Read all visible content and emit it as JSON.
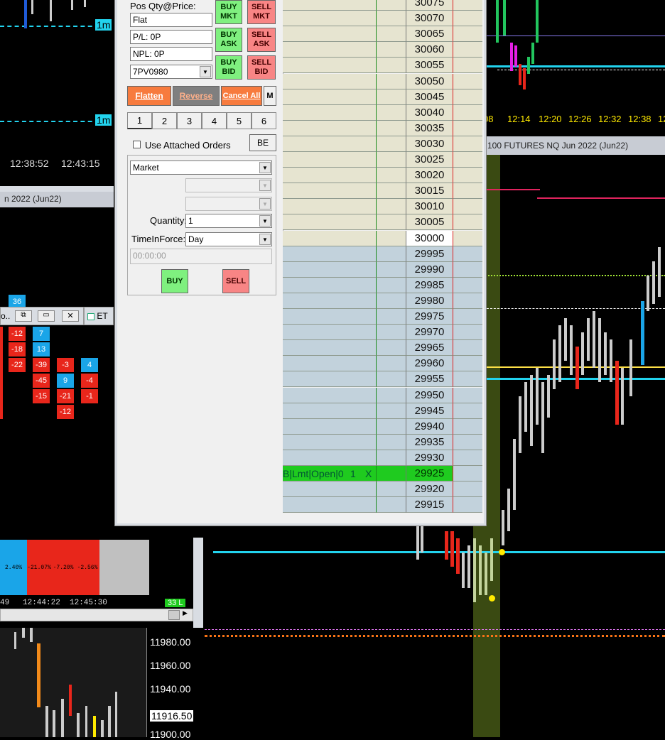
{
  "top_left_chart": {
    "labels": [
      "1m",
      "1m"
    ],
    "times": [
      "12:38:52",
      "12:43:15"
    ]
  },
  "left_window": {
    "title": "n 2022 (Jun22)",
    "top_value": "36",
    "column_a": [
      "-12",
      "-18",
      "-22"
    ],
    "column_b": [
      "7",
      "13"
    ],
    "column_c": [
      "-39",
      "-45",
      "-15"
    ],
    "column_d": [
      "-3",
      "9",
      "-21",
      "-12"
    ],
    "column_e": [
      "4",
      "-4",
      "-1"
    ],
    "pct_values": [
      "2.40%",
      "-21.07%",
      "-7.20%",
      "-2.56%"
    ],
    "times": [
      "49",
      "12:44:22",
      "12:45:30"
    ],
    "badge": "33 L",
    "tab_label": "ET"
  },
  "bottom_left_chart": {
    "prices": [
      "11980.00",
      "11960.00",
      "11940.00",
      "11916.50",
      "11900.00"
    ]
  },
  "top_right_chart": {
    "times": [
      "08",
      "12:14",
      "12:20",
      "12:26",
      "12:32",
      "12:38",
      "12"
    ]
  },
  "right_window": {
    "title": "100 FUTURES NQ Jun 2022 (Jun22)"
  },
  "order_entry": {
    "pos_label": "Pos Qty@Price:",
    "pos_value": "Flat",
    "pl_value": "P/L: 0P",
    "npl_value": "NPL: 0P",
    "account": "7PV0980",
    "buy_mkt": [
      "BUY",
      "MKT"
    ],
    "sell_mkt": [
      "SELL",
      "MKT"
    ],
    "buy_ask": [
      "BUY",
      "ASK"
    ],
    "sell_ask": [
      "SELL",
      "ASK"
    ],
    "buy_bid": [
      "BUY",
      "BID"
    ],
    "sell_bid": [
      "SELL",
      "BID"
    ],
    "flatten": "Flatten",
    "reverse": "Reverse",
    "cancel_all": "Cancel All",
    "m": "M",
    "tabs": [
      "1",
      "2",
      "3",
      "4",
      "5",
      "6"
    ],
    "use_attached": "Use Attached Orders",
    "be": "BE",
    "order_type": "Market",
    "quantity_label": "Quantity:",
    "quantity": "1",
    "tif_label": "TimeInForce:",
    "tif": "Day",
    "time": "00:00:00",
    "buy": "BUY",
    "sell": "SELL"
  },
  "ladder": {
    "prices": [
      "30075",
      "30070",
      "30065",
      "30060",
      "30055",
      "30050",
      "30045",
      "30040",
      "30035",
      "30030",
      "30025",
      "30020",
      "30015",
      "30010",
      "30005",
      "30000",
      "29995",
      "29990",
      "29985",
      "29980",
      "29975",
      "29970",
      "29965",
      "29960",
      "29955",
      "29950",
      "29945",
      "29940",
      "29935",
      "29930",
      "29925",
      "29920",
      "29915"
    ],
    "current_price": "30000",
    "order_price": "29925",
    "order_text": "B|Lmt|Open|0",
    "order_qty": "1",
    "order_cancel": "X"
  }
}
